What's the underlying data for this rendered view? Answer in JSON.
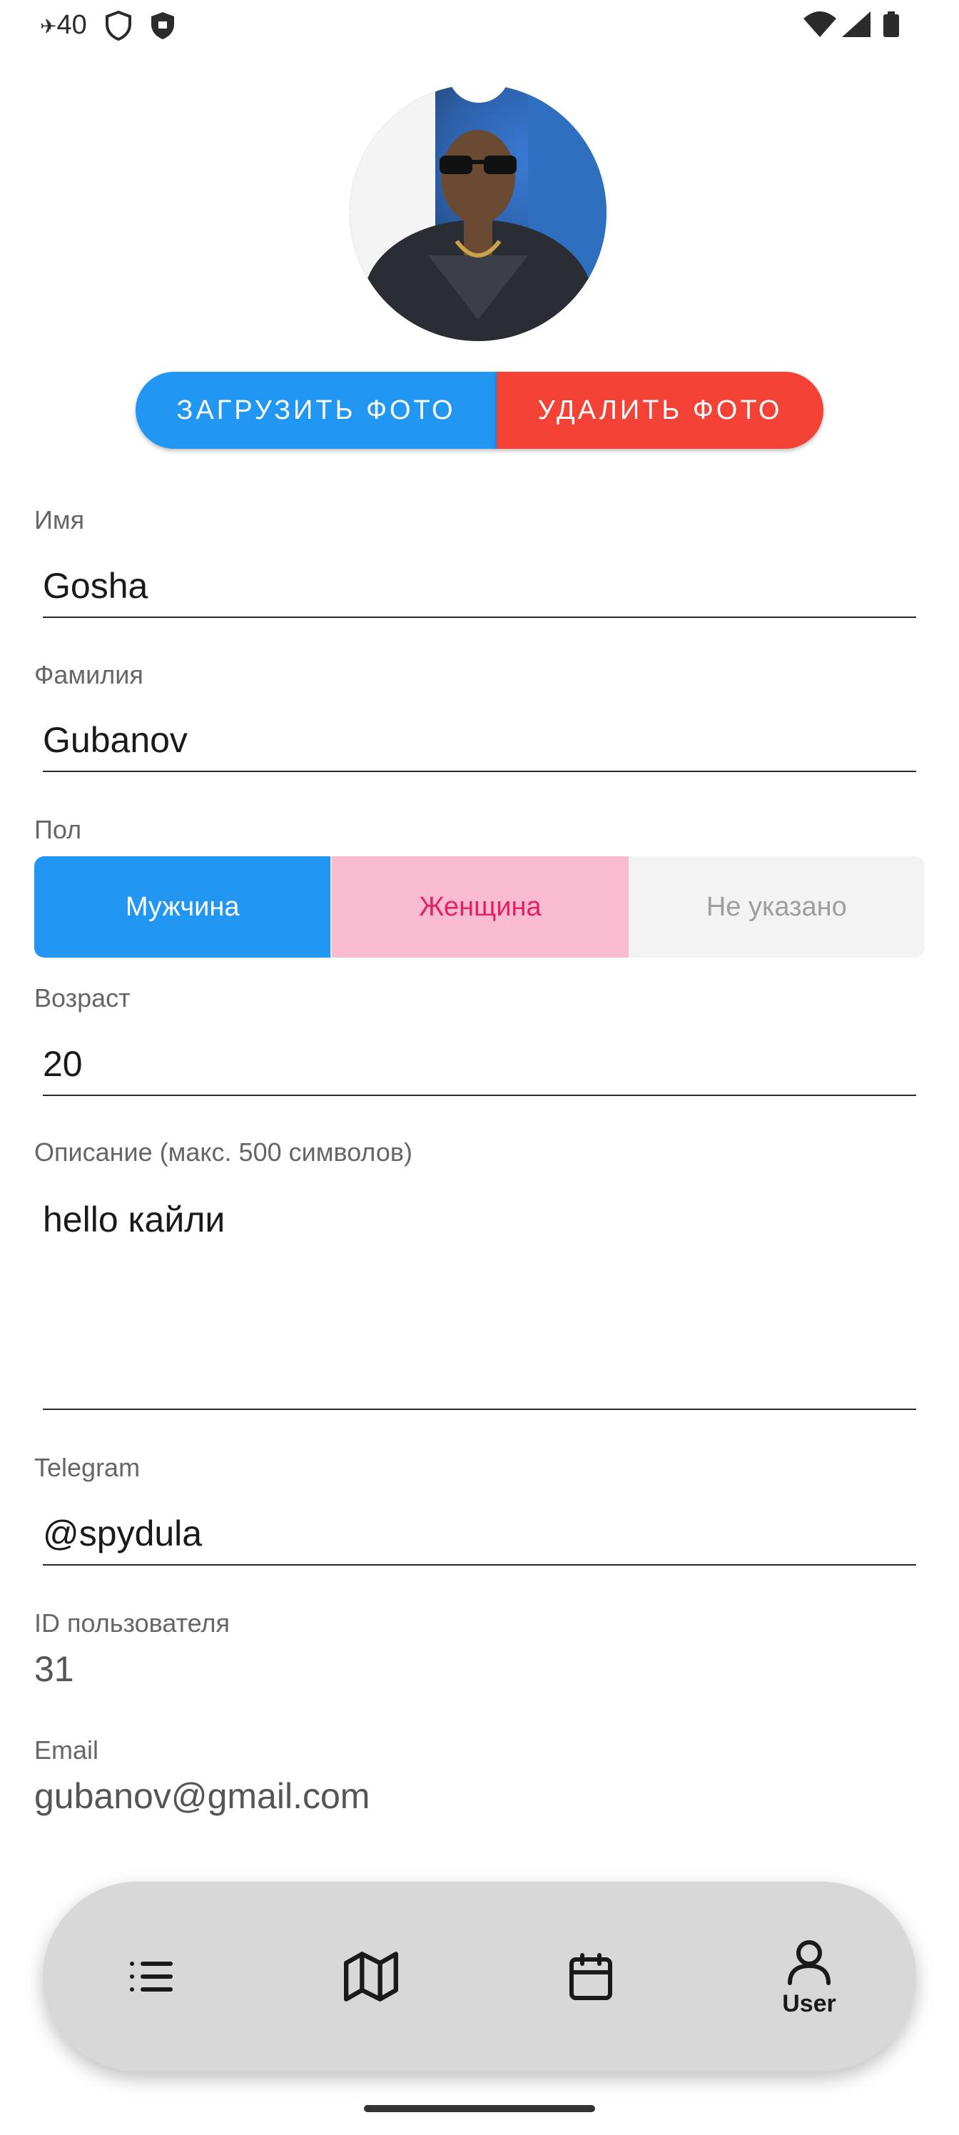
{
  "status_bar": {
    "time": "40"
  },
  "profile": {
    "buttons": {
      "upload": "ЗАГРУЗИТЬ ФОТО",
      "delete": "УДАЛИТЬ ФОТО"
    },
    "first_name": {
      "label": "Имя",
      "value": "Gosha"
    },
    "last_name": {
      "label": "Фамилия",
      "value": "Gubanov"
    },
    "gender": {
      "label": "Пол",
      "options": [
        "Мужчина",
        "Женщина",
        "Не указано"
      ],
      "selected": "Мужчина"
    },
    "age": {
      "label": "Возраст",
      "value": "20"
    },
    "description": {
      "label": "Описание (макс. 500 символов)",
      "value": "hello кайли"
    },
    "telegram": {
      "label": "Telegram",
      "value": "@spydula"
    },
    "user_id": {
      "label": "ID пользователя",
      "value": "31"
    },
    "email": {
      "label": "Email",
      "value": "gubanov@gmail.com"
    }
  },
  "bottom_nav": {
    "items": [
      {
        "icon": "list-icon",
        "label": ""
      },
      {
        "icon": "map-icon",
        "label": ""
      },
      {
        "icon": "calendar-icon",
        "label": ""
      },
      {
        "icon": "user-icon",
        "label": "User",
        "active": true
      }
    ]
  },
  "colors": {
    "primary": "#2196f3",
    "danger": "#f44336",
    "female": "#f8bbd0"
  }
}
